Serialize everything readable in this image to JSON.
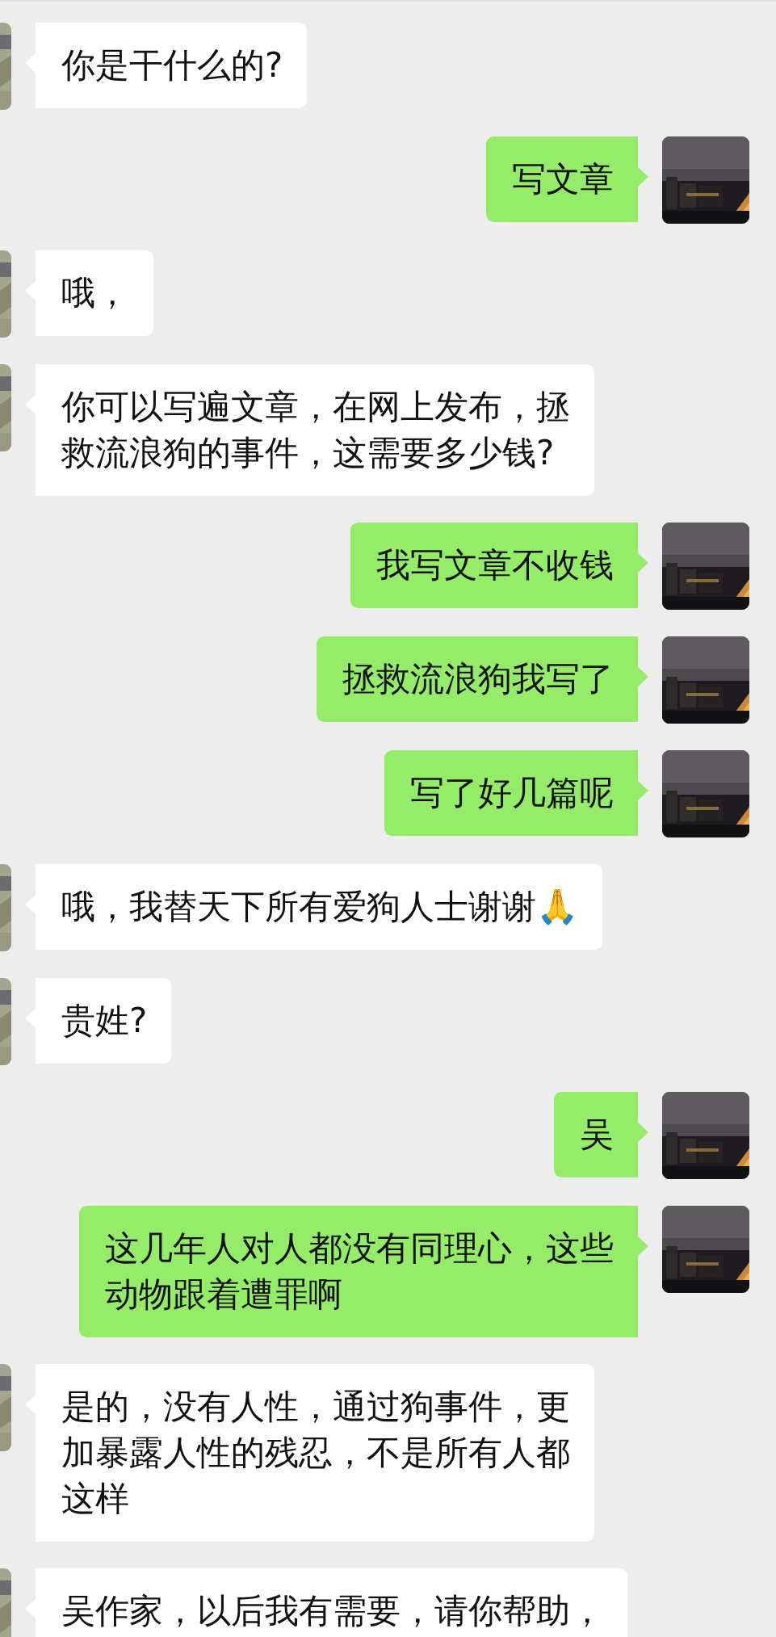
{
  "messages": [
    {
      "kind": "received",
      "lines": [
        "你是干什么的?"
      ]
    },
    {
      "kind": "sent",
      "lines": [
        "写文章"
      ]
    },
    {
      "kind": "received",
      "lines": [
        "哦，"
      ]
    },
    {
      "kind": "received",
      "lines": [
        "你可以写遍文章，在网上发布，拯",
        "救流浪狗的事件，这需要多少钱?"
      ]
    },
    {
      "kind": "sent",
      "lines": [
        "我写文章不收钱"
      ]
    },
    {
      "kind": "sent",
      "lines": [
        "拯救流浪狗我写了"
      ]
    },
    {
      "kind": "sent",
      "lines": [
        "写了好几篇呢"
      ]
    },
    {
      "kind": "received",
      "lines": [
        "哦，我替天下所有爱狗人士谢谢🙏"
      ]
    },
    {
      "kind": "received",
      "lines": [
        "贵姓?"
      ]
    },
    {
      "kind": "sent",
      "lines": [
        "吴"
      ]
    },
    {
      "kind": "sent",
      "lines": [
        "这几年人对人都没有同理心，这些",
        "动物跟着遭罪啊"
      ]
    },
    {
      "kind": "received",
      "lines": [
        "是的，没有人性，通过狗事件，更",
        "加暴露人性的残忍，不是所有人都",
        "这样"
      ]
    },
    {
      "kind": "received",
      "lines": [
        "吴作家，以后我有需要，请你帮助，"
      ]
    }
  ]
}
